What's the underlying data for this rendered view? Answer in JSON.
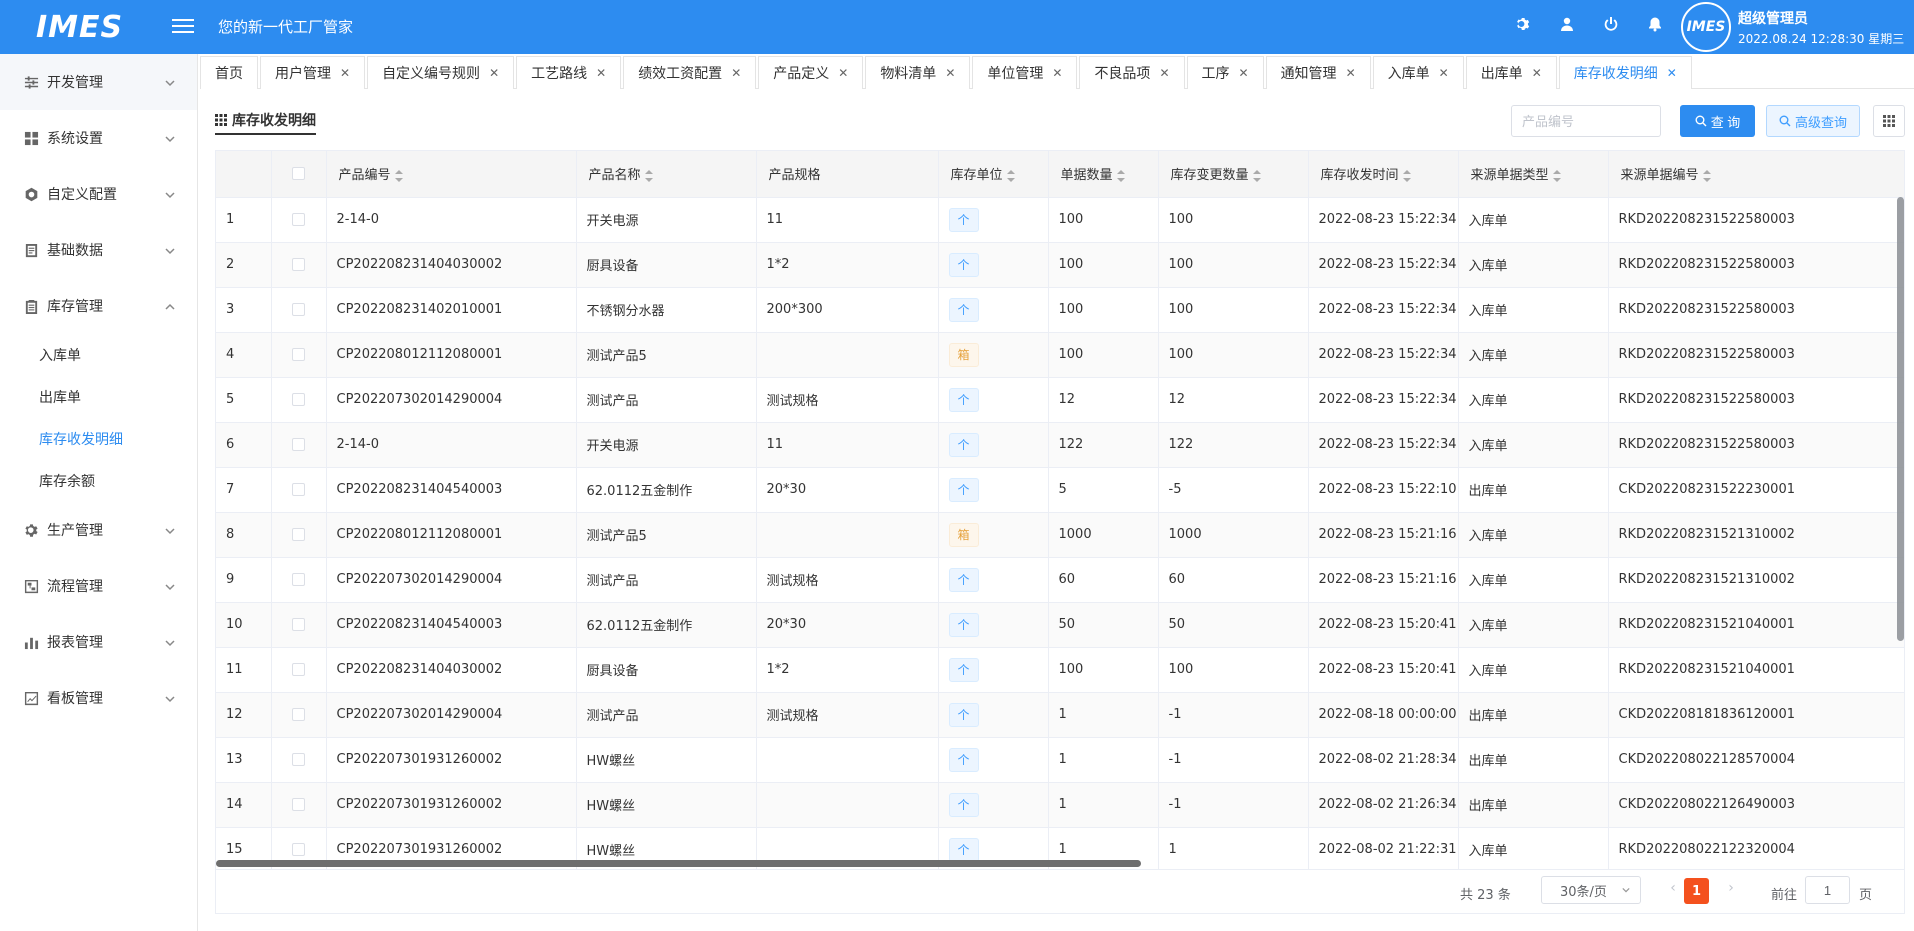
{
  "header": {
    "logo": "IMES",
    "slogan": "您的新一代工厂管家",
    "avatar_text": "IMES",
    "user_name": "超级管理员",
    "datetime": "2022.08.24 12:28:30 星期三",
    "icons": [
      "settings-icon",
      "user-icon",
      "power-icon",
      "bell-icon"
    ]
  },
  "sidebar": {
    "groups": [
      {
        "label": "开发管理",
        "icon": "sliders-icon",
        "expanded": false
      },
      {
        "label": "系统设置",
        "icon": "grid-icon",
        "expanded": false
      },
      {
        "label": "自定义配置",
        "icon": "gear-icon",
        "expanded": false
      },
      {
        "label": "基础数据",
        "icon": "document-icon",
        "expanded": false
      },
      {
        "label": "库存管理",
        "icon": "clipboard-icon",
        "expanded": true
      },
      {
        "label": "生产管理",
        "icon": "cog-icon",
        "expanded": false
      },
      {
        "label": "流程管理",
        "icon": "flow-icon",
        "expanded": false
      },
      {
        "label": "报表管理",
        "icon": "bar-chart-icon",
        "expanded": false
      },
      {
        "label": "看板管理",
        "icon": "line-chart-icon",
        "expanded": false
      }
    ],
    "inventory_children": [
      "入库单",
      "出库单",
      "库存收发明细",
      "库存余额"
    ],
    "active_child": "库存收发明细"
  },
  "tabs": [
    {
      "label": "首页",
      "closable": false
    },
    {
      "label": "用户管理",
      "closable": true
    },
    {
      "label": "自定义编号规则",
      "closable": true
    },
    {
      "label": "工艺路线",
      "closable": true
    },
    {
      "label": "绩效工资配置",
      "closable": true
    },
    {
      "label": "产品定义",
      "closable": true
    },
    {
      "label": "物料清单",
      "closable": true
    },
    {
      "label": "单位管理",
      "closable": true
    },
    {
      "label": "不良品项",
      "closable": true
    },
    {
      "label": "工序",
      "closable": true
    },
    {
      "label": "通知管理",
      "closable": true
    },
    {
      "label": "入库单",
      "closable": true
    },
    {
      "label": "出库单",
      "closable": true
    },
    {
      "label": "库存收发明细",
      "closable": true,
      "active": true
    }
  ],
  "toolbar": {
    "sub_tab": "库存收发明细",
    "search_placeholder": "产品编号",
    "query_label": "查 询",
    "advanced_label": "高级查询"
  },
  "table": {
    "columns": [
      "产品编号",
      "产品名称",
      "产品规格",
      "库存单位",
      "单据数量",
      "库存变更数量",
      "库存收发时间",
      "来源单据类型",
      "来源单据编号"
    ],
    "rows": [
      [
        "1",
        "2-14-0",
        "开关电源",
        "11",
        "个",
        "100",
        "100",
        "2022-08-23 15:22:34",
        "入库单",
        "RKD202208231522580003"
      ],
      [
        "2",
        "CP202208231404030002",
        "厨具设备",
        "1*2",
        "个",
        "100",
        "100",
        "2022-08-23 15:22:34",
        "入库单",
        "RKD202208231522580003"
      ],
      [
        "3",
        "CP202208231402010001",
        "不锈钢分水器",
        "200*300",
        "个",
        "100",
        "100",
        "2022-08-23 15:22:34",
        "入库单",
        "RKD202208231522580003"
      ],
      [
        "4",
        "CP202208012112080001",
        "测试产品5",
        "",
        "箱",
        "100",
        "100",
        "2022-08-23 15:22:34",
        "入库单",
        "RKD202208231522580003"
      ],
      [
        "5",
        "CP202207302014290004",
        "测试产品",
        "测试规格",
        "个",
        "12",
        "12",
        "2022-08-23 15:22:34",
        "入库单",
        "RKD202208231522580003"
      ],
      [
        "6",
        "2-14-0",
        "开关电源",
        "11",
        "个",
        "122",
        "122",
        "2022-08-23 15:22:34",
        "入库单",
        "RKD202208231522580003"
      ],
      [
        "7",
        "CP202208231404540003",
        "62.0112五金制作",
        "20*30",
        "个",
        "5",
        "-5",
        "2022-08-23 15:22:10",
        "出库单",
        "CKD202208231522230001"
      ],
      [
        "8",
        "CP202208012112080001",
        "测试产品5",
        "",
        "箱",
        "1000",
        "1000",
        "2022-08-23 15:21:16",
        "入库单",
        "RKD202208231521310002"
      ],
      [
        "9",
        "CP202207302014290004",
        "测试产品",
        "测试规格",
        "个",
        "60",
        "60",
        "2022-08-23 15:21:16",
        "入库单",
        "RKD202208231521310002"
      ],
      [
        "10",
        "CP202208231404540003",
        "62.0112五金制作",
        "20*30",
        "个",
        "50",
        "50",
        "2022-08-23 15:20:41",
        "入库单",
        "RKD202208231521040001"
      ],
      [
        "11",
        "CP202208231404030002",
        "厨具设备",
        "1*2",
        "个",
        "100",
        "100",
        "2022-08-23 15:20:41",
        "入库单",
        "RKD202208231521040001"
      ],
      [
        "12",
        "CP202207302014290004",
        "测试产品",
        "测试规格",
        "个",
        "1",
        "-1",
        "2022-08-18 00:00:00",
        "出库单",
        "CKD202208181836120001"
      ],
      [
        "13",
        "CP202207301931260002",
        "HW螺丝",
        "",
        "个",
        "1",
        "-1",
        "2022-08-02 21:28:34",
        "出库单",
        "CKD202208022128570004"
      ],
      [
        "14",
        "CP202207301931260002",
        "HW螺丝",
        "",
        "个",
        "1",
        "-1",
        "2022-08-02 21:26:34",
        "出库单",
        "CKD202208022126490003"
      ],
      [
        "15",
        "CP202207301931260002",
        "HW螺丝",
        "",
        "个",
        "1",
        "1",
        "2022-08-02 21:22:31",
        "入库单",
        "RKD202208022122320004"
      ]
    ]
  },
  "pagination": {
    "total_text": "共 23 条",
    "page_size": "30条/页",
    "current_page": "1",
    "goto_label": "前往",
    "goto_value": "1",
    "page_unit": "页"
  },
  "colors": {
    "primary": "#2d8cf0",
    "page_active": "#f4511e",
    "tag_blue": "#409eff",
    "tag_orange": "#e6a23c"
  }
}
